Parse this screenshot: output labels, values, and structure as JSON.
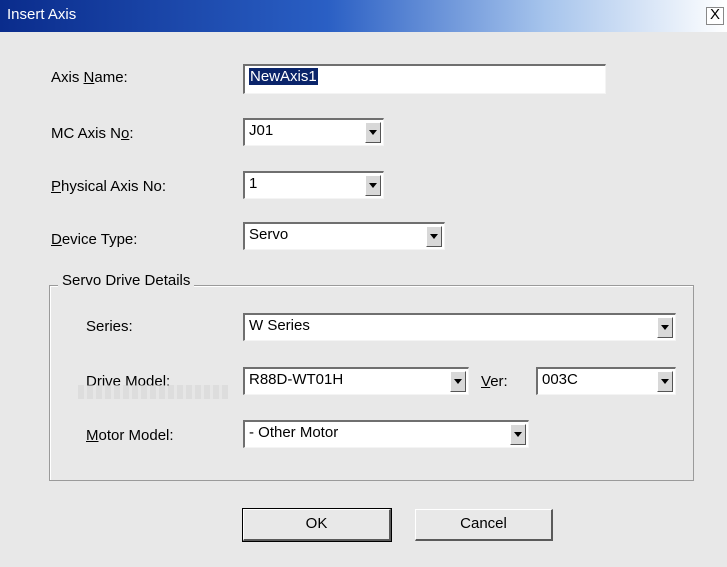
{
  "window": {
    "title": "Insert Axis",
    "close_glyph": "X"
  },
  "fields": {
    "axis_name": {
      "label_pre": "Axis ",
      "label_mn": "N",
      "label_post": "ame:",
      "value": "NewAxis1"
    },
    "mc_axis_no": {
      "label_pre": "MC Axis N",
      "label_mn": "o",
      "label_post": ":",
      "value": "J01"
    },
    "physical_axis_no": {
      "label_pre": "",
      "label_mn": "P",
      "label_post": "hysical Axis No:",
      "value": "1"
    },
    "device_type": {
      "label_pre": "",
      "label_mn": "D",
      "label_post": "evice Type:",
      "value": "Servo"
    }
  },
  "servo_group": {
    "title": "Servo Drive Details",
    "series": {
      "label": "Series:",
      "value": "W Series"
    },
    "drive_model": {
      "label": "Drive Model:",
      "value": "R88D-WT01H"
    },
    "ver": {
      "label_mn": "V",
      "label_post": "er:",
      "value": "003C"
    },
    "motor_model": {
      "label_pre": "",
      "label_mn": "M",
      "label_post": "otor Model:",
      "value": "- Other Motor"
    }
  },
  "buttons": {
    "ok": "OK",
    "cancel": "Cancel"
  },
  "colors": {
    "title_start": "#0a2c8c",
    "title_end": "#ffffff",
    "dialog_bg": "#e8e8e8",
    "selection": "#0a246a"
  }
}
